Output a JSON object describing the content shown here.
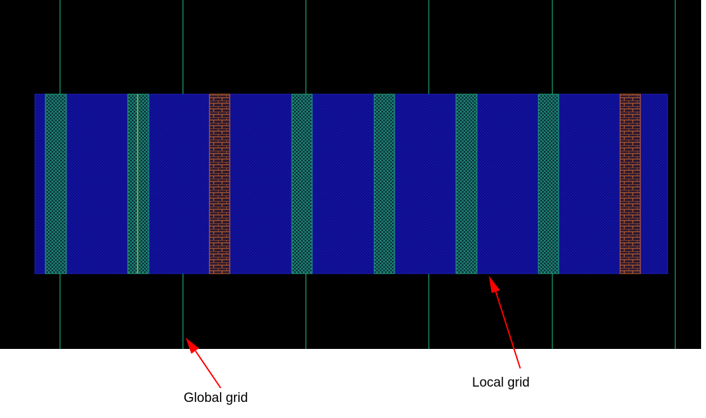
{
  "annotations": {
    "global_grid": "Global grid",
    "local_grid": "Local grid"
  },
  "colors": {
    "background": "#000000",
    "cell": "#0a0a8a",
    "global_line": "#1a9a6a",
    "local_stripe_green": "#20a080",
    "local_stripe_orange": "#d06a30",
    "yellow_line": "#c8c830",
    "arrow": "#ff0000",
    "page": "#ffffff"
  },
  "stripe_types": [
    "green",
    "green",
    "orange",
    "green",
    "green",
    "green",
    "green",
    "orange"
  ]
}
